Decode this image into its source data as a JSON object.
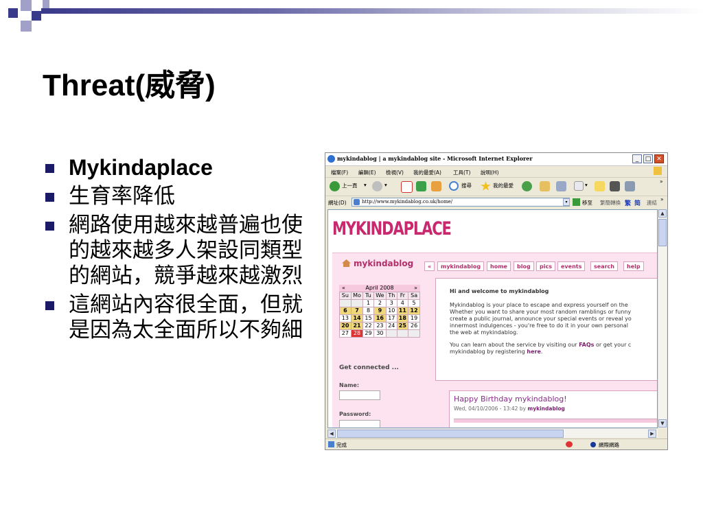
{
  "slide": {
    "title": "Threat(威脅)",
    "bullets": [
      "Mykindaplace",
      "生育率降低",
      "網路使用越來越普遍也使的越來越多人架設同類型的網站，競爭越來越激烈",
      "這網站內容很全面，但就是因為太全面所以不夠細"
    ]
  },
  "browser": {
    "window_title": "mykindablog | a mykindablog site - Microsoft Internet Explorer",
    "menu": [
      "檔案(F)",
      "編輯(E)",
      "檢視(V)",
      "我的最愛(A)",
      "工具(T)",
      "說明(H)"
    ],
    "toolbar": {
      "back": "上一頁",
      "search": "搜尋",
      "favorites": "我的最愛"
    },
    "address_label": "網址(D)",
    "url": "http://www.mykindablog.co.uk/home/",
    "go_label": "移至",
    "links": {
      "translate": "繁簡轉換",
      "trad": "繁",
      "simp": "简",
      "more": "連結"
    },
    "status_text": "完成",
    "zone_text": "網際網路"
  },
  "site": {
    "logo_text": "MYKINDAPLACE",
    "blog_title": "mykindablog",
    "nav": [
      "«",
      "mykindablog",
      "home",
      "blog",
      "pics",
      "events",
      "search",
      "help"
    ],
    "calendar": {
      "prev": "«",
      "month": "April 2008",
      "next": "»",
      "days": [
        "Su",
        "Mo",
        "Tu",
        "We",
        "Th",
        "Fr",
        "Sa"
      ],
      "weeks": [
        [
          "",
          "",
          "1",
          "2",
          "3",
          "4",
          "5"
        ],
        [
          "6",
          "7",
          "8",
          "9",
          "10",
          "11",
          "12"
        ],
        [
          "13",
          "14",
          "15",
          "16",
          "17",
          "18",
          "19"
        ],
        [
          "20",
          "21",
          "22",
          "23",
          "24",
          "25",
          "26"
        ],
        [
          "27",
          "28",
          "29",
          "30",
          "",
          "",
          ""
        ]
      ],
      "today": "28",
      "event_days": [
        "6",
        "7",
        "9",
        "11",
        "12",
        "14",
        "16",
        "18",
        "20",
        "21",
        "25"
      ]
    },
    "get_connected": "Get connected ...",
    "name_label": "Name:",
    "password_label": "Password:",
    "welcome_heading": "Hi and welcome to mykindablog",
    "intro_lines": [
      "Mykindablog is your place to escape and express yourself on the",
      "Whether you want to share your most random ramblings or funny",
      "create a public journal, announce your special events or reveal yo",
      "innermost indulgences - you're free to do it in your own personal",
      "the web at mykindablog."
    ],
    "learn_pre": "You can learn about the service by visiting our",
    "faqs_link": "FAQs",
    "learn_mid": "or get your c",
    "learn_line2_pre": "mykindablog by registering",
    "here_link": "here",
    "learn_line2_post": ".",
    "post_title": "Happy Birthday mykindablog!",
    "post_meta_pre": "Wed, 04/10/2006 - 13:42 by",
    "post_author": "mykindablog"
  }
}
